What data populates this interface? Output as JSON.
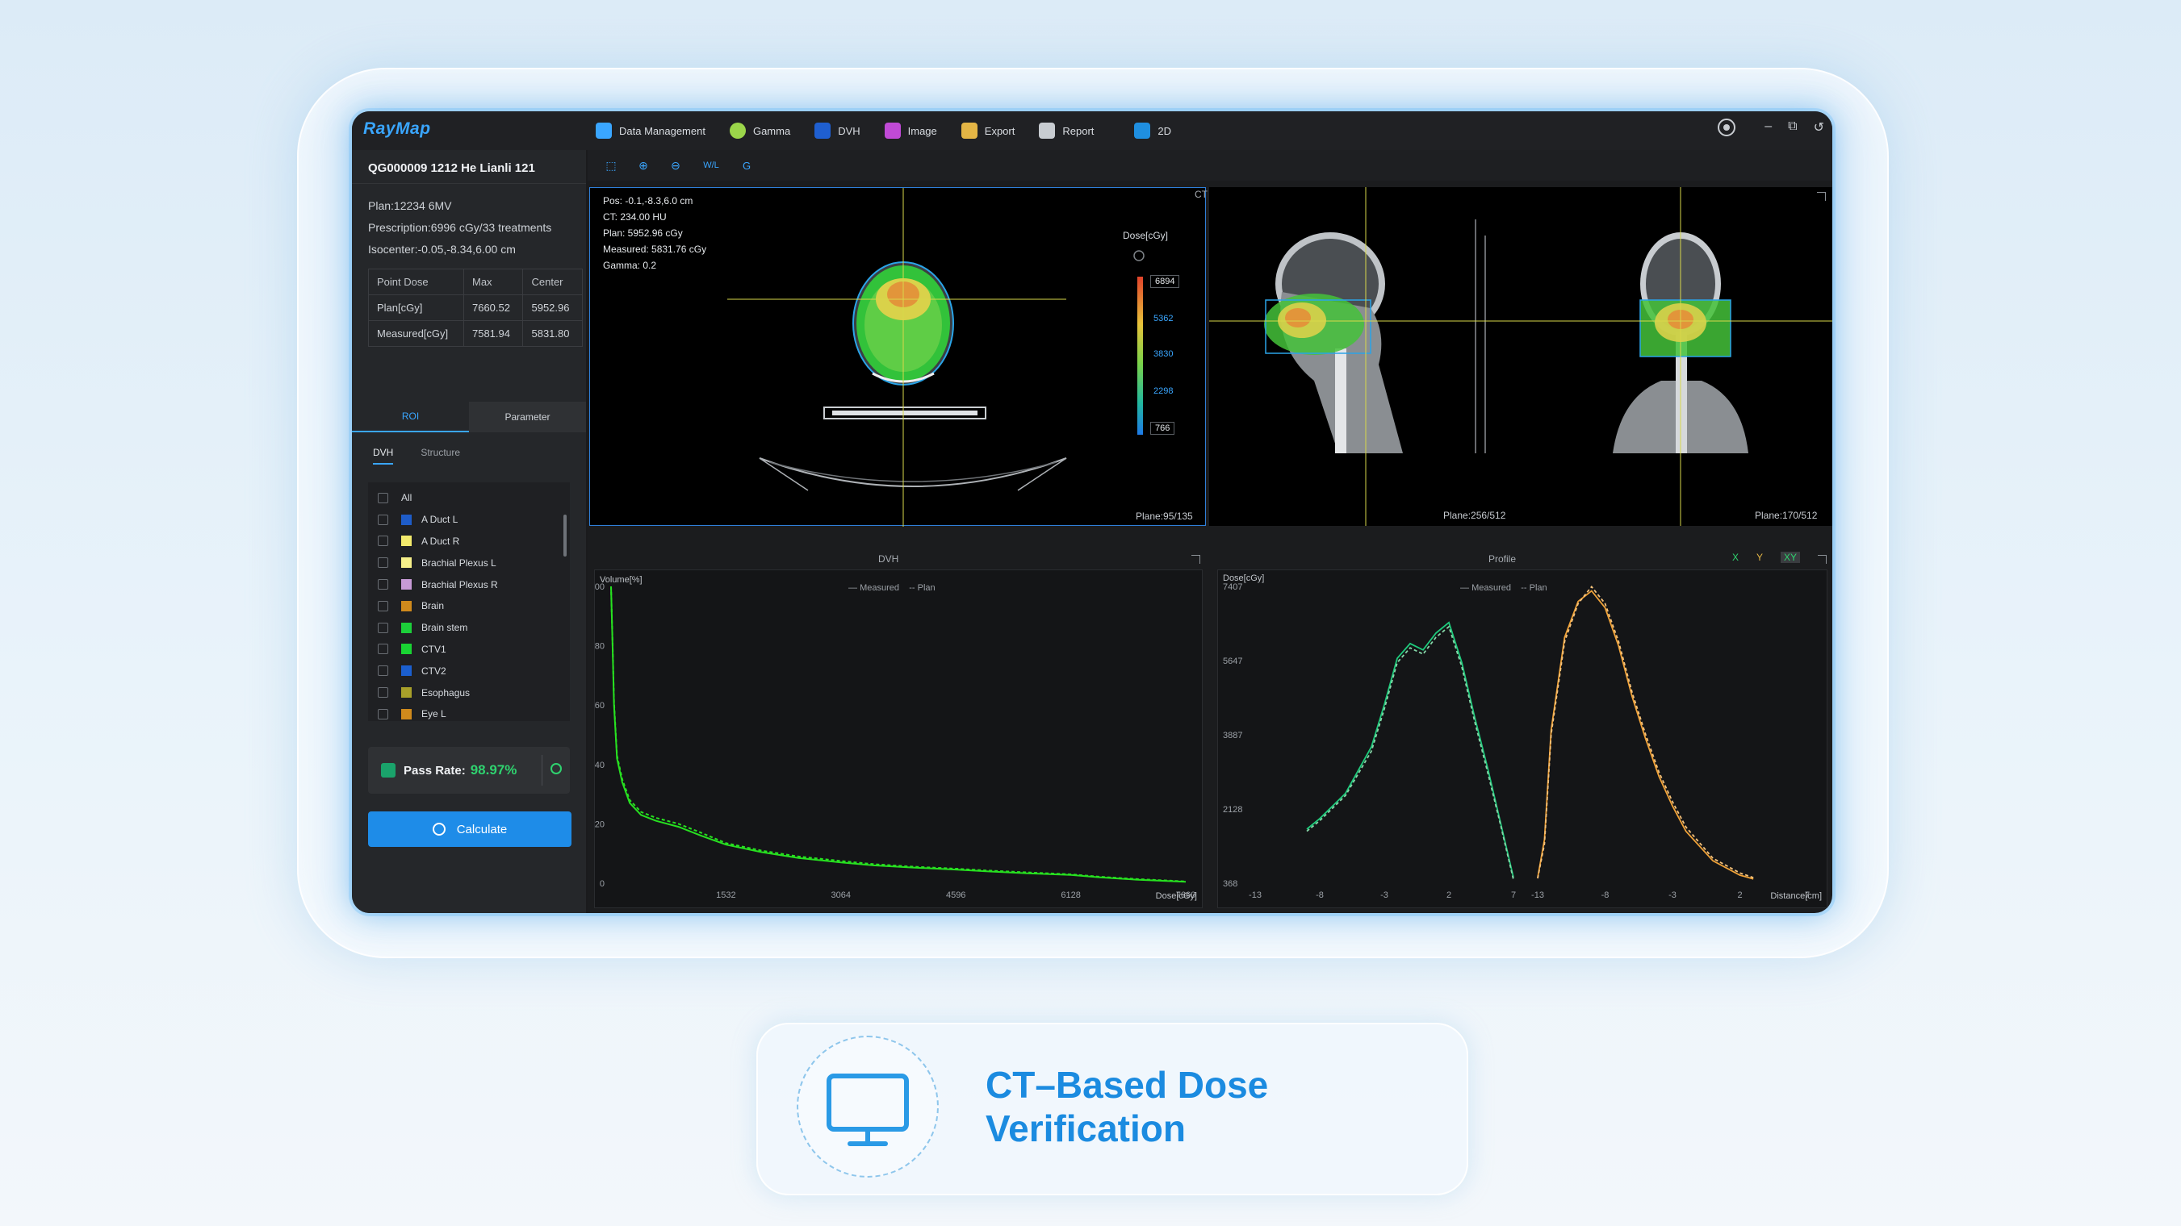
{
  "app": {
    "logo": "RayMap"
  },
  "menu": [
    {
      "label": "Data Management",
      "color": "#3aa6ff"
    },
    {
      "label": "Gamma",
      "color": "#9bd64a"
    },
    {
      "label": "DVH",
      "color": "#3aa6ff"
    },
    {
      "label": "Image",
      "color": "#c04ad6"
    },
    {
      "label": "Export",
      "color": "#e3b545"
    },
    {
      "label": "Report",
      "color": "#c8ccd1"
    },
    {
      "label": "2D",
      "color": "#3aa6ff"
    }
  ],
  "window_controls": {
    "minimize": "–",
    "restore": "⧉",
    "close": "↺"
  },
  "patient": {
    "header": "QG000009 1212  He Lianli 121"
  },
  "plan": {
    "plan": "Plan:12234 6MV",
    "prescription": "Prescription:6996 cGy/33 treatments",
    "isocenter": "Isocenter:-0.05,-8.34,6.00 cm"
  },
  "point_dose": {
    "headers": [
      "Point Dose",
      "Max",
      "Center"
    ],
    "rows": [
      [
        "Plan[cGy]",
        "7660.52",
        "5952.96"
      ],
      [
        "Measured[cGy]",
        "7581.94",
        "5831.80"
      ]
    ]
  },
  "tabs": {
    "roi": "ROI",
    "parameter": "Parameter"
  },
  "subtabs": {
    "dvh": "DVH",
    "structure": "Structure"
  },
  "roi_list": [
    {
      "label": "All",
      "color": ""
    },
    {
      "label": "A Duct L",
      "color": "#1e5cc8"
    },
    {
      "label": "A Duct R",
      "color": "#f3ea6c"
    },
    {
      "label": "Brachial Plexus L",
      "color": "#f6f08a"
    },
    {
      "label": "Brachial Plexus R",
      "color": "#c79ad6"
    },
    {
      "label": "Brain",
      "color": "#d08a1c"
    },
    {
      "label": "Brain stem",
      "color": "#1ccf3a"
    },
    {
      "label": "CTV1",
      "color": "#19d433"
    },
    {
      "label": "CTV2",
      "color": "#1b5fcf"
    },
    {
      "label": "Esophagus",
      "color": "#a8a02a"
    },
    {
      "label": "Eye L",
      "color": "#d08a1c"
    }
  ],
  "pass_rate": {
    "label": "Pass Rate:",
    "value": "98.97%"
  },
  "calculate": {
    "label": "Calculate"
  },
  "toolbar": {
    "wl": "W/L",
    "g": "G"
  },
  "ct_panel": {
    "title": "CT",
    "readout": [
      "Pos: -0.1,-8.3,6.0 cm",
      "CT: 234.00 HU",
      "Plan: 5952.96 cGy",
      "Measured: 5831.76 cGy",
      "Gamma: 0.2"
    ],
    "dose_title": "Dose[cGy]",
    "dose_labels": [
      "6894",
      "5362",
      "3830",
      "2298",
      "766"
    ],
    "plane_axial": "Plane:95/135",
    "plane_sag": "Plane:256/512",
    "plane_cor": "Plane:170/512"
  },
  "chart_data": [
    {
      "type": "line",
      "title": "DVH",
      "xlabel": "Dose[cGy]",
      "ylabel": "Volume[%]",
      "xlim": [
        0,
        7660
      ],
      "ylim": [
        0,
        100
      ],
      "x_ticks": [
        "1532",
        "3064",
        "4596",
        "6128",
        "7660"
      ],
      "y_ticks": [
        "0",
        "20",
        "40",
        "60",
        "80",
        "100"
      ],
      "legend": [
        "Measured",
        "Plan"
      ],
      "legend_position": "top-center",
      "series": [
        {
          "name": "Measured",
          "color": "#27e020",
          "x": [
            0,
            20,
            40,
            80,
            150,
            250,
            400,
            600,
            900,
            1200,
            1532,
            2000,
            2500,
            3064,
            3500,
            4000,
            4596,
            5000,
            5500,
            6128,
            6500,
            7000,
            7660
          ],
          "y": [
            100,
            80,
            60,
            42,
            34,
            27,
            23,
            21,
            19,
            16,
            13,
            10.5,
            8.5,
            7,
            6,
            5.3,
            4.6,
            4,
            3.4,
            2.8,
            2,
            1.2,
            0.5
          ]
        },
        {
          "name": "Plan",
          "color": "#27e020",
          "x": [
            0,
            20,
            40,
            80,
            150,
            250,
            400,
            600,
            900,
            1200,
            1532,
            2000,
            2500,
            3064,
            3500,
            4000,
            4596,
            5000,
            5500,
            6128,
            6500,
            7000,
            7660
          ],
          "y": [
            100,
            81,
            61,
            43,
            35,
            28,
            24,
            22,
            20,
            17,
            13.5,
            11,
            9,
            7.5,
            6.4,
            5.6,
            4.9,
            4.3,
            3.7,
            3,
            2.2,
            1.4,
            0.6
          ]
        }
      ]
    },
    {
      "type": "line",
      "title": "Profile",
      "xlabel": "Distance[cm]",
      "ylabel": "Dose[cGy]",
      "ylim": [
        368,
        7407
      ],
      "y_ticks": [
        "368",
        "2128",
        "3887",
        "5647",
        "7407"
      ],
      "x_ticks": [
        "-13",
        "-8",
        "-3",
        "2",
        "7",
        "-13",
        "-8",
        "-3",
        "2",
        "7"
      ],
      "axis_toggles": [
        "X",
        "Y",
        "XY"
      ],
      "legend": [
        "Measured",
        "Plan"
      ],
      "legend_position": "top-center",
      "series": [
        {
          "name": "X Measured",
          "color": "#1ecb7c",
          "x": [
            -9,
            -8,
            -6,
            -4,
            -3,
            -2,
            -1,
            0,
            1,
            2,
            3,
            4,
            5,
            6,
            7
          ],
          "y": [
            1650,
            1900,
            2500,
            3600,
            4600,
            5700,
            6050,
            5900,
            6300,
            6550,
            5600,
            4300,
            3100,
            1800,
            500
          ]
        },
        {
          "name": "X Plan",
          "color": "#86d6a8",
          "x": [
            -9,
            -8,
            -6,
            -4,
            -3,
            -2,
            -1,
            0,
            1,
            2,
            3,
            4,
            5,
            6,
            7
          ],
          "y": [
            1600,
            1850,
            2450,
            3500,
            4500,
            5600,
            5950,
            5800,
            6200,
            6450,
            5500,
            4200,
            3000,
            1750,
            450
          ]
        },
        {
          "name": "Y Measured",
          "color": "#f0a238",
          "x": [
            -13,
            -12.5,
            -12,
            -11,
            -10,
            -9,
            -8,
            -7,
            -6,
            -5,
            -4,
            -3,
            -2,
            0,
            2,
            3
          ],
          "y": [
            500,
            1400,
            4000,
            6200,
            7050,
            7300,
            6900,
            6000,
            4800,
            3800,
            2900,
            2200,
            1600,
            900,
            560,
            470
          ]
        },
        {
          "name": "Y Plan",
          "color": "#f5c17a",
          "x": [
            -13,
            -12.5,
            -12,
            -11,
            -10,
            -9,
            -8,
            -7,
            -6,
            -5,
            -4,
            -3,
            -2,
            0,
            2,
            3
          ],
          "y": [
            480,
            1300,
            3900,
            6100,
            7000,
            7400,
            7000,
            6100,
            4900,
            3900,
            3000,
            2300,
            1700,
            960,
            610,
            500
          ]
        }
      ]
    }
  ],
  "card": {
    "title": "CT–Based Dose Verification"
  }
}
